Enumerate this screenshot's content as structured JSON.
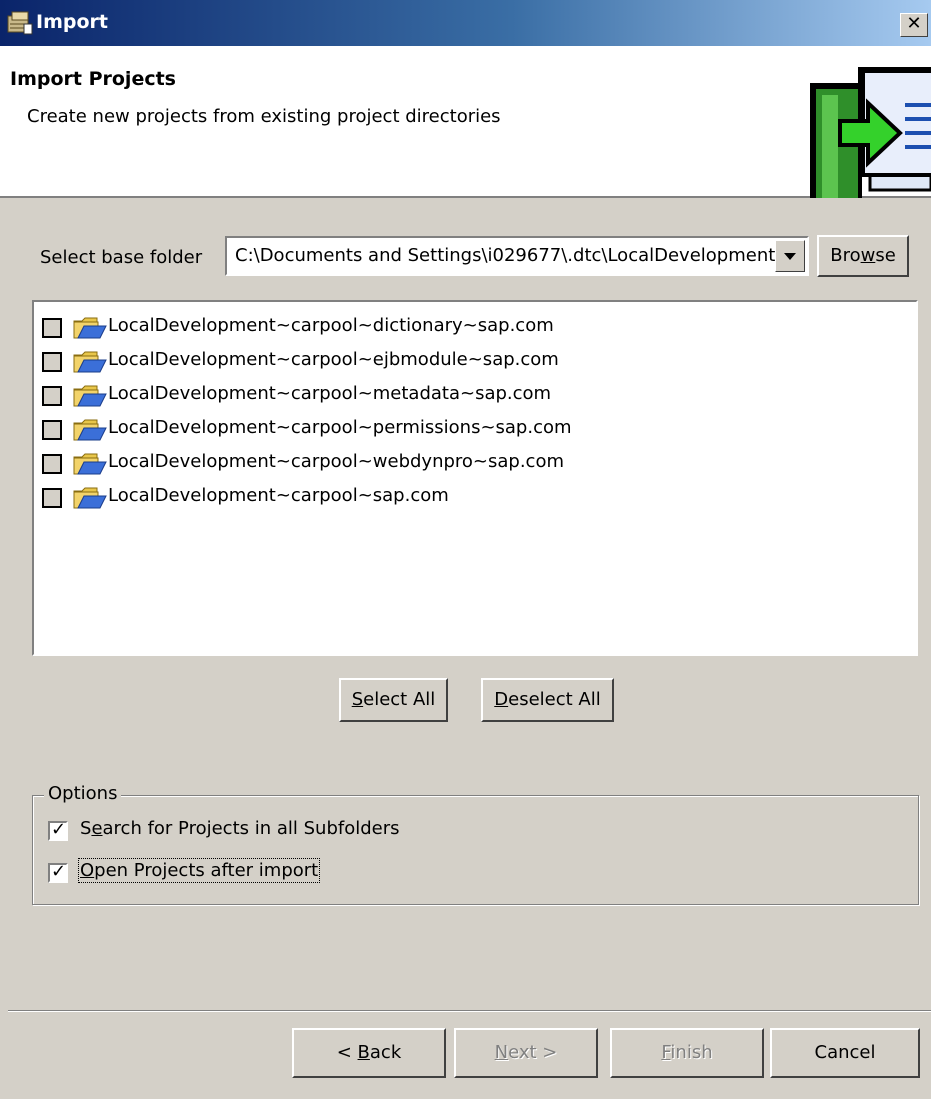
{
  "window": {
    "title": "Import",
    "close_label": "✕"
  },
  "header": {
    "title": "Import Projects",
    "description": "Create new projects from existing project directories"
  },
  "folder": {
    "label": "Select base folder",
    "value": "C:\\Documents and Settings\\i029677\\.dtc\\LocalDevelopment",
    "browse_label": "Browse"
  },
  "projects": [
    {
      "label": "LocalDevelopment~carpool~dictionary~sap.com",
      "checked": false
    },
    {
      "label": "LocalDevelopment~carpool~ejbmodule~sap.com",
      "checked": false
    },
    {
      "label": "LocalDevelopment~carpool~metadata~sap.com",
      "checked": false
    },
    {
      "label": "LocalDevelopment~carpool~permissions~sap.com",
      "checked": false
    },
    {
      "label": "LocalDevelopment~carpool~webdynpro~sap.com",
      "checked": false
    },
    {
      "label": "LocalDevelopment~carpool~sap.com",
      "checked": false
    }
  ],
  "list_buttons": {
    "select_all": "Select All",
    "deselect_all": "Deselect All"
  },
  "options": {
    "group_label": "Options",
    "search_subfolders": {
      "label": "Search for Projects in all Subfolders",
      "checked": true
    },
    "open_after_import": {
      "label": "Open Projects after import",
      "checked": true
    }
  },
  "footer": {
    "back": "< Back",
    "next": "Next >",
    "finish": "Finish",
    "cancel": "Cancel"
  },
  "icons": {
    "title": "import-wizard-icon",
    "folder": "folder-icon",
    "wizard_banner": "import-arrow-icon",
    "dropdown": "chevron-down-icon"
  },
  "colors": {
    "titlebar_start": "#0a246a",
    "titlebar_end": "#a6caf0",
    "dialog_bg": "#d4d0c8",
    "wizard_green": "#3cb043"
  }
}
